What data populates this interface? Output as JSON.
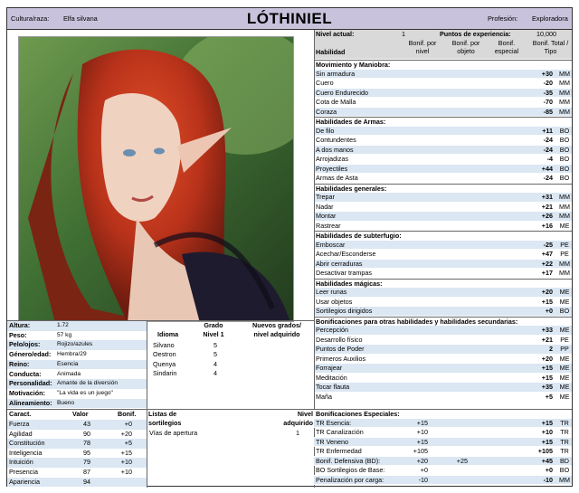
{
  "header": {
    "culture_label": "Cultura/raza:",
    "culture_value": "Elfa silvana",
    "name": "LÓTHINIEL",
    "profession_label": "Profesión:",
    "profession_value": "Exploradora"
  },
  "level_bar": {
    "level_label": "Nivel actual:",
    "level_value": "1",
    "xp_label": "Puntos de experiencia:",
    "xp_value": "10,000"
  },
  "skills_header": {
    "habilidad": "Habilidad",
    "bonif_nivel": "Bonif. por nivel",
    "bonif_objeto": "Bonif. por objeto",
    "bonif_especial": "Bonif. especial",
    "total_tipo": "Bonif. Total / Tipo"
  },
  "skill_sections": [
    {
      "title": "Movimiento y Maniobra:",
      "rows": [
        {
          "name": "Sin armadura",
          "total": "+30",
          "type": "MM"
        },
        {
          "name": "Cuero",
          "total": "-20",
          "type": "MM"
        },
        {
          "name": "Cuero Endurecido",
          "total": "-35",
          "type": "MM"
        },
        {
          "name": "Cota de Malla",
          "total": "-70",
          "type": "MM"
        },
        {
          "name": "Coraza",
          "total": "-85",
          "type": "MM"
        }
      ]
    },
    {
      "title": "Habilidades de Armas:",
      "rows": [
        {
          "name": "De filo",
          "total": "+11",
          "type": "BO"
        },
        {
          "name": "Contundentes",
          "total": "-24",
          "type": "BO"
        },
        {
          "name": "A dos manos",
          "total": "-24",
          "type": "BO"
        },
        {
          "name": "Arrojadizas",
          "total": "-4",
          "type": "BO"
        },
        {
          "name": "Proyectiles",
          "total": "+44",
          "type": "BO"
        },
        {
          "name": "Armas de Asta",
          "total": "-24",
          "type": "BO"
        }
      ]
    },
    {
      "title": "Habilidades generales:",
      "rows": [
        {
          "name": "Trepar",
          "total": "+31",
          "type": "MM"
        },
        {
          "name": "Nadar",
          "total": "+21",
          "type": "MM"
        },
        {
          "name": "Montar",
          "total": "+26",
          "type": "MM"
        },
        {
          "name": "Rastrear",
          "total": "+16",
          "type": "ME"
        }
      ]
    },
    {
      "title": "Habilidades de subterfugio:",
      "rows": [
        {
          "name": "Emboscar",
          "total": "-25",
          "type": "PE"
        },
        {
          "name": "Acechar/Esconderse",
          "total": "+47",
          "type": "PE"
        },
        {
          "name": "Abrir cerraduras",
          "total": "+22",
          "type": "MM"
        },
        {
          "name": "Desactivar trampas",
          "total": "+17",
          "type": "MM"
        }
      ]
    },
    {
      "title": "Habilidades mágicas:",
      "rows": [
        {
          "name": "Leer runas",
          "total": "+20",
          "type": "ME"
        },
        {
          "name": "Usar objetos",
          "total": "+15",
          "type": "ME"
        },
        {
          "name": "Sortilegios dirigidos",
          "total": "+0",
          "type": "BO"
        }
      ]
    },
    {
      "title": "Bonificaciones para otras habilidades y habilidades secundarias:",
      "rows": [
        {
          "name": "Percepción",
          "total": "+33",
          "type": "ME"
        },
        {
          "name": "Desarrollo físico",
          "total": "+21",
          "type": "PE"
        },
        {
          "name": "Puntos de Poder",
          "total": "2",
          "type": "PP"
        },
        {
          "name": "Primeros Auxilios",
          "total": "+20",
          "type": "ME"
        },
        {
          "name": "Forrajear",
          "total": "+15",
          "type": "ME"
        },
        {
          "name": "Meditación",
          "total": "+15",
          "type": "ME"
        },
        {
          "name": "Tocar flauta",
          "total": "+35",
          "type": "ME"
        },
        {
          "name": "Maña",
          "total": "+5",
          "type": "ME"
        }
      ]
    }
  ],
  "special": {
    "title": "Bonificaciones Especiales:",
    "rows": [
      {
        "name": "TR Esencia:",
        "nivel": "+15",
        "objeto": "",
        "total": "+15",
        "type": "TR"
      },
      {
        "name": "TR Canalización",
        "nivel": "+10",
        "objeto": "",
        "total": "+10",
        "type": "TR"
      },
      {
        "name": "TR Veneno",
        "nivel": "+15",
        "objeto": "",
        "total": "+15",
        "type": "TR"
      },
      {
        "name": "TR Enfermedad",
        "nivel": "+105",
        "objeto": "",
        "total": "+105",
        "type": "TR"
      },
      {
        "name": "Bonif. Defensiva (BD):",
        "nivel": "+20",
        "objeto": "+25",
        "total": "+45",
        "type": "BD"
      },
      {
        "name": "BO Sortilegios de Base:",
        "nivel": "+0",
        "objeto": "",
        "total": "+0",
        "type": "BO"
      },
      {
        "name": "Penalización por carga:",
        "nivel": "-10",
        "objeto": "",
        "total": "-10",
        "type": "MM"
      }
    ]
  },
  "bio": [
    {
      "label": "Altura:",
      "value": "1.72"
    },
    {
      "label": "Peso:",
      "value": "57 kg"
    },
    {
      "label": "Pelo/ojos:",
      "value": "Rojizo/azules"
    },
    {
      "label": "Género/edad:",
      "value": "Hembra/29"
    },
    {
      "label": "Reino:",
      "value": "Esencia"
    },
    {
      "label": "Conducta:",
      "value": "Animada"
    },
    {
      "label": "Personalidad:",
      "value": "Amante de la diversión"
    },
    {
      "label": "Motivación:",
      "value": "\"La vida es un juego\""
    },
    {
      "label": "Alineamiento:",
      "value": "Bueno"
    }
  ],
  "languages": {
    "idioma_label": "Idioma",
    "grado_label": "Grado Nivel 1",
    "nuevos_label": "Nuevos grados/ nivel adquirido",
    "rows": [
      {
        "name": "Silvano",
        "grade": "5"
      },
      {
        "name": "Oestron",
        "grade": "5"
      },
      {
        "name": "Quenya",
        "grade": "4"
      },
      {
        "name": "Sindarin",
        "grade": "4"
      }
    ]
  },
  "stats": {
    "caract_label": "Caract.",
    "valor_label": "Valor",
    "bonif_label": "Bonif.",
    "rows": [
      {
        "name": "Fuerza",
        "value": "43",
        "bonus": "+0"
      },
      {
        "name": "Agilidad",
        "value": "90",
        "bonus": "+20"
      },
      {
        "name": "Constitución",
        "value": "78",
        "bonus": "+5"
      },
      {
        "name": "Inteligencia",
        "value": "95",
        "bonus": "+15"
      },
      {
        "name": "Intuición",
        "value": "79",
        "bonus": "+10"
      },
      {
        "name": "Presencia",
        "value": "87",
        "bonus": "+10"
      },
      {
        "name": "Apariencia",
        "value": "94",
        "bonus": ""
      }
    ]
  },
  "spells": {
    "lists_label": "Listas de sortilegios",
    "level_label": "Nivel adquirido",
    "rows": [
      {
        "name": "Vías de apertura",
        "level": "1"
      }
    ]
  }
}
